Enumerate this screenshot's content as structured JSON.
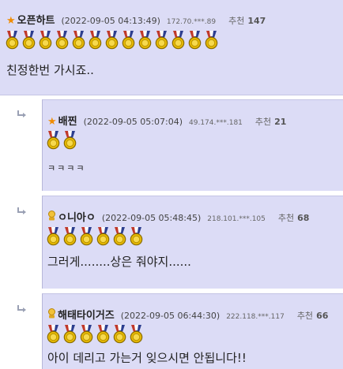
{
  "comments": [
    {
      "badge": "star-icon",
      "nick": "오픈하트",
      "date": "(2022-09-05 04:13:49)",
      "ip": "172.70.***.89",
      "rec_label": "추천",
      "rec_count": "147",
      "medal_count": 13,
      "text": "친정한번 가시죠.."
    },
    {
      "badge": "star-icon",
      "nick": "배찐",
      "date": "(2022-09-05 05:07:04)",
      "ip": "49.174.***.181",
      "rec_label": "추천",
      "rec_count": "21",
      "medal_count": 2,
      "text": "ㅋㅋㅋㅋ"
    },
    {
      "badge": "member-icon",
      "nick": "ㅇ니아ㅇ",
      "date": "(2022-09-05 05:48:45)",
      "ip": "218.101.***.105",
      "rec_label": "추천",
      "rec_count": "68",
      "medal_count": 6,
      "text": "그러게........상은 줘야지......"
    },
    {
      "badge": "member-icon",
      "nick": "해태타이거즈",
      "date": "(2022-09-05 06:44:30)",
      "ip": "222.118.***.117",
      "rec_label": "추천",
      "rec_count": "66",
      "medal_count": 6,
      "text": "아이 데리고 가는거 잊으시면 안됩니다!!"
    }
  ],
  "colors": {
    "comment_bg": "#dcdcf6",
    "star": "#f08c00",
    "medal_gold": "#e6b800",
    "ribbon_red": "#c0392b",
    "ribbon_blue": "#2c3e8f"
  }
}
